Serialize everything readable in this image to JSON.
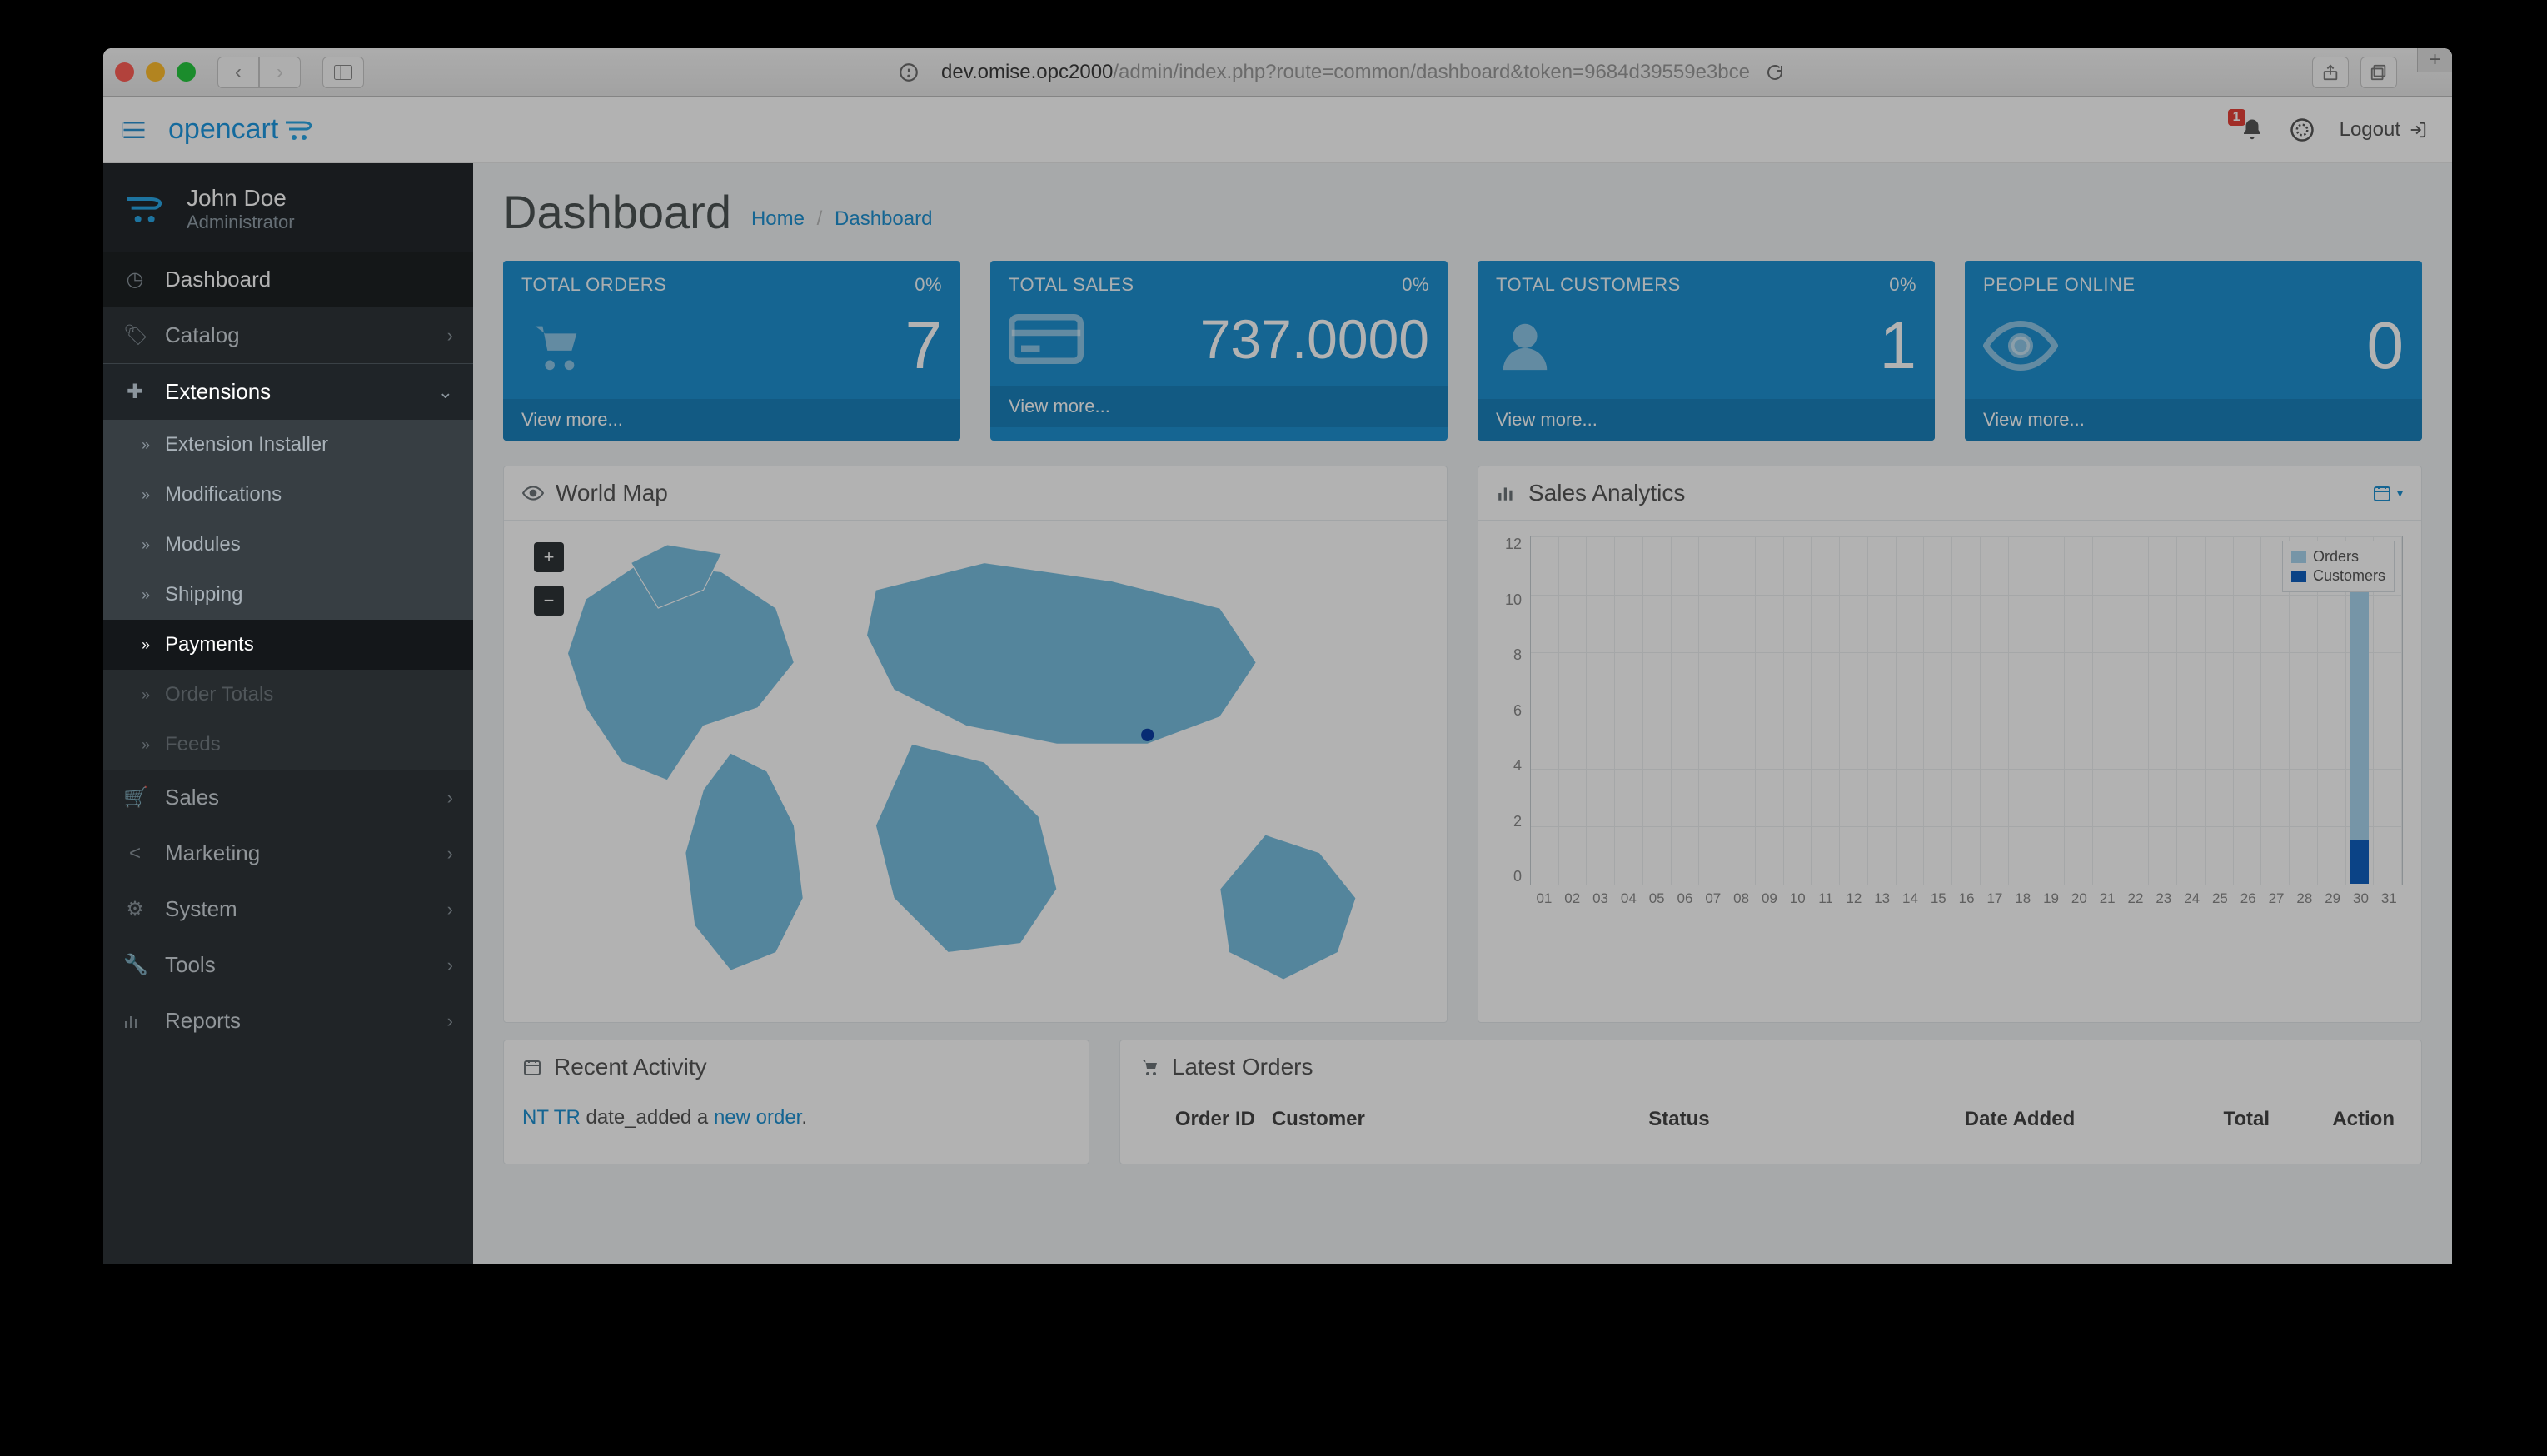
{
  "browser": {
    "url_host": "dev.omise.opc2000",
    "url_path": "/admin/index.php?route=common/dashboard&token=9684d39559e3bce"
  },
  "header": {
    "logo_text": "opencart",
    "notification_count": "1",
    "logout_label": "Logout"
  },
  "user": {
    "name": "John Doe",
    "role": "Administrator"
  },
  "nav": {
    "dashboard": "Dashboard",
    "catalog": "Catalog",
    "extensions": "Extensions",
    "ext_items": {
      "installer": "Extension Installer",
      "modifications": "Modifications",
      "modules": "Modules",
      "shipping": "Shipping",
      "payments": "Payments",
      "order_totals": "Order Totals",
      "feeds": "Feeds"
    },
    "sales": "Sales",
    "marketing": "Marketing",
    "system": "System",
    "tools": "Tools",
    "reports": "Reports"
  },
  "page": {
    "title": "Dashboard",
    "crumb_home": "Home",
    "crumb_current": "Dashboard"
  },
  "tiles": {
    "orders": {
      "label": "TOTAL ORDERS",
      "pct": "0%",
      "value": "7",
      "more": "View more..."
    },
    "sales": {
      "label": "TOTAL SALES",
      "pct": "0%",
      "value": "737.0000",
      "more": "View more..."
    },
    "customers": {
      "label": "TOTAL CUSTOMERS",
      "pct": "0%",
      "value": "1",
      "more": "View more..."
    },
    "online": {
      "label": "PEOPLE ONLINE",
      "pct": "",
      "value": "0",
      "more": "View more..."
    }
  },
  "panels": {
    "map_title": "World Map",
    "analytics_title": "Sales Analytics",
    "recent_title": "Recent Activity",
    "latest_title": "Latest Orders",
    "zoom_in": "+",
    "zoom_out": "−"
  },
  "recent": {
    "user": "NT TR",
    "mid": "date_added a",
    "link": "new order",
    "tail": "."
  },
  "orders_table": {
    "h_oid": "Order ID",
    "h_cust": "Customer",
    "h_stat": "Status",
    "h_date": "Date Added",
    "h_total": "Total",
    "h_act": "Action"
  },
  "analytics_legend": {
    "orders": "Orders",
    "customers": "Customers"
  },
  "chart_data": {
    "type": "bar",
    "title": "Sales Analytics",
    "xlabel": "",
    "ylabel": "",
    "ylim": [
      0,
      12
    ],
    "y_ticks": [
      0,
      2,
      4,
      6,
      8,
      10,
      12
    ],
    "categories": [
      "01",
      "02",
      "03",
      "04",
      "05",
      "06",
      "07",
      "08",
      "09",
      "10",
      "11",
      "12",
      "13",
      "14",
      "15",
      "16",
      "17",
      "18",
      "19",
      "20",
      "21",
      "22",
      "23",
      "24",
      "25",
      "26",
      "27",
      "28",
      "29",
      "30",
      "31"
    ],
    "series": [
      {
        "name": "Orders",
        "values": [
          0,
          0,
          0,
          0,
          0,
          0,
          0,
          0,
          0,
          0,
          0,
          0,
          0,
          0,
          0,
          0,
          0,
          0,
          0,
          0,
          0,
          0,
          0,
          0,
          0,
          0,
          0,
          0,
          0,
          10,
          0
        ]
      },
      {
        "name": "Customers",
        "values": [
          0,
          0,
          0,
          0,
          0,
          0,
          0,
          0,
          0,
          0,
          0,
          0,
          0,
          0,
          0,
          0,
          0,
          0,
          0,
          0,
          0,
          0,
          0,
          0,
          0,
          0,
          0,
          0,
          0,
          1.5,
          0
        ]
      }
    ]
  }
}
